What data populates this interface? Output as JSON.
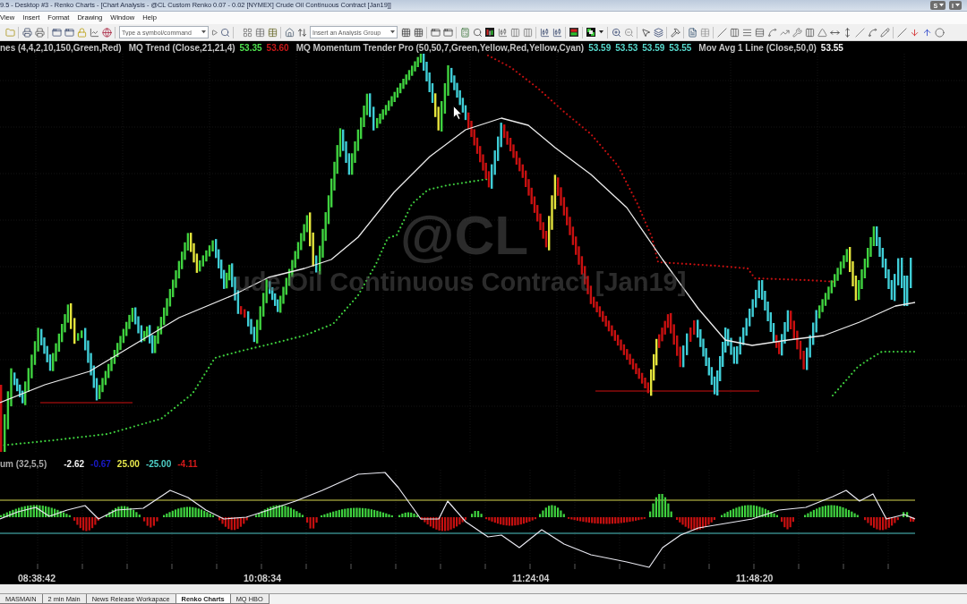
{
  "window": {
    "title": "9.5 - Desktop #3 - Renko Charts - [Chart Analysis - @CL Custom Renko 0.07 - 0.02 [NYMEX] Crude Oil Continuous Contract [Jan19]]",
    "buttons": [
      "S",
      "I"
    ]
  },
  "menu": [
    "View",
    "Insert",
    "Format",
    "Drawing",
    "Window",
    "Help"
  ],
  "toolbar": {
    "symbol_field": {
      "placeholder": "Type a symbol/command"
    },
    "analysis_group_field": {
      "placeholder": "Insert an Analysis Group"
    }
  },
  "price_chart": {
    "legend": [
      {
        "label": "nes (4,4,2,10,150,Green,Red)"
      },
      {
        "label": "MQ Trend (Close,21,21,4)",
        "values": [
          {
            "text": "53.35",
            "color": "#4ee04e"
          },
          {
            "text": "53.60",
            "color": "#c81818"
          }
        ]
      },
      {
        "label": "MQ Momentum Trender Pro (50,50,7,Green,Yellow,Red,Yellow,Cyan)",
        "values": [
          {
            "text": "53.59",
            "color": "#56d8cc"
          },
          {
            "text": "53.53",
            "color": "#56d8cc"
          },
          {
            "text": "53.59",
            "color": "#56d8cc"
          },
          {
            "text": "53.55",
            "color": "#56d8cc"
          }
        ]
      },
      {
        "label": "Mov Avg 1 Line (Close,50,0)",
        "values": [
          {
            "text": "53.55",
            "color": "#f4f4f4"
          }
        ]
      }
    ],
    "watermark": {
      "symbol": "@CL",
      "description": "ude Oil Continuous Contract [Jan19]"
    }
  },
  "indicator": {
    "label": "um (32,5,5)",
    "values": [
      {
        "text": "-2.62",
        "color": "#f0f0f0"
      },
      {
        "text": "-0.67",
        "color": "#1a1acc"
      },
      {
        "text": "25.00",
        "color": "#e8e84c"
      },
      {
        "text": "-25.00",
        "color": "#4ed0c8"
      },
      {
        "text": "-4.11",
        "color": "#d41a1a"
      }
    ]
  },
  "time_axis": {
    "labels": [
      "08:38:42",
      "10:08:34",
      "11:24:04",
      "11:48:20"
    ]
  },
  "workspace_tabs": [
    {
      "label": "MASMAIN",
      "selected": false
    },
    {
      "label": "2 min Main",
      "selected": false
    },
    {
      "label": "News Release Workapace",
      "selected": false
    },
    {
      "label": "Renko Charts",
      "selected": true
    },
    {
      "label": "MQ HBO",
      "selected": false
    }
  ]
}
